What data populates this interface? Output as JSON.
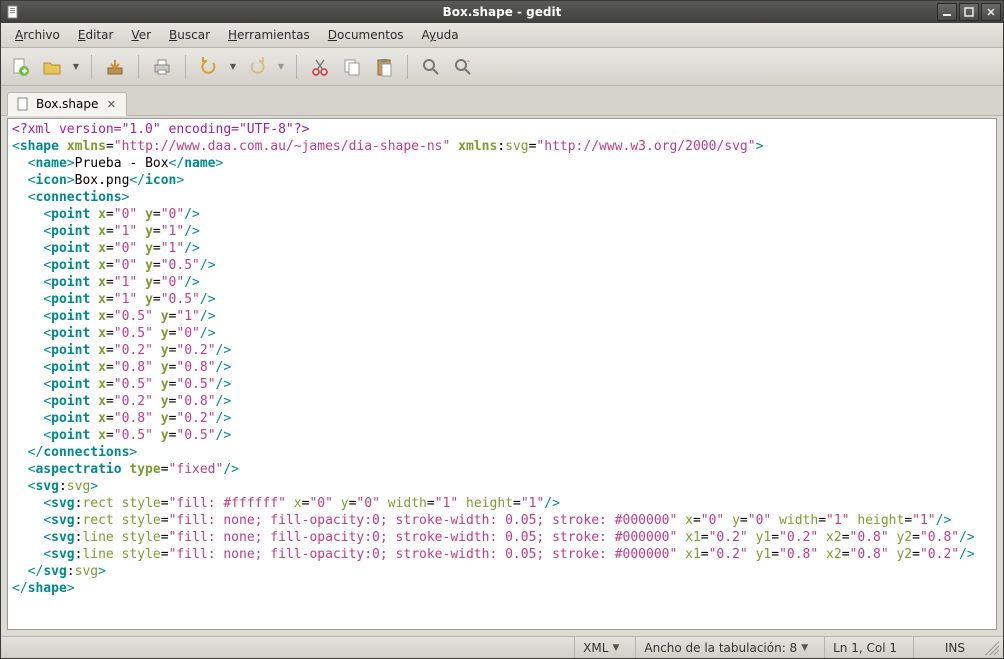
{
  "window": {
    "title": "Box.shape - gedit"
  },
  "menu": {
    "archivo": "Archivo",
    "editar": "Editar",
    "ver": "Ver",
    "buscar": "Buscar",
    "herramientas": "Herramientas",
    "documentos": "Documentos",
    "ayuda": "Ayuda"
  },
  "tab": {
    "label": "Box.shape"
  },
  "status": {
    "lang": "XML",
    "tabwidth": "Ancho de la tabulación: 8",
    "cursor": "Ln 1, Col 1",
    "ins": "INS"
  },
  "code": {
    "xml_decl": "<?xml version=\"1.0\" encoding=\"UTF-8\"?>",
    "shape_open": {
      "ns1": "http://www.daa.com.au/~james/dia-shape-ns",
      "ns2": "http://www.w3.org/2000/svg"
    },
    "name": "Prueba - Box",
    "icon": "Box.png",
    "points": [
      {
        "x": "0",
        "y": "0"
      },
      {
        "x": "1",
        "y": "1"
      },
      {
        "x": "0",
        "y": "1"
      },
      {
        "x": "0",
        "y": "0.5"
      },
      {
        "x": "1",
        "y": "0"
      },
      {
        "x": "1",
        "y": "0.5"
      },
      {
        "x": "0.5",
        "y": "1"
      },
      {
        "x": "0.5",
        "y": "0"
      },
      {
        "x": "0.2",
        "y": "0.2"
      },
      {
        "x": "0.8",
        "y": "0.8"
      },
      {
        "x": "0.5",
        "y": "0.5"
      },
      {
        "x": "0.2",
        "y": "0.8"
      },
      {
        "x": "0.8",
        "y": "0.2"
      },
      {
        "x": "0.5",
        "y": "0.5"
      }
    ],
    "aspect_type": "fixed",
    "rect1": {
      "style": "fill: #ffffff",
      "x": "0",
      "y": "0",
      "width": "1",
      "height": "1"
    },
    "rect2": {
      "style": "fill: none; fill-opacity:0; stroke-width: 0.05; stroke: #000000",
      "x": "0",
      "y": "0",
      "width": "1",
      "height": "1"
    },
    "line1": {
      "style": "fill: none; fill-opacity:0; stroke-width: 0.05; stroke: #000000",
      "x1": "0.2",
      "y1": "0.2",
      "x2": "0.8",
      "y2": "0.8"
    },
    "line2": {
      "style": "fill: none; fill-opacity:0; stroke-width: 0.05; stroke: #000000",
      "x1": "0.2",
      "y1": "0.8",
      "x2": "0.8",
      "y2": "0.2"
    }
  }
}
